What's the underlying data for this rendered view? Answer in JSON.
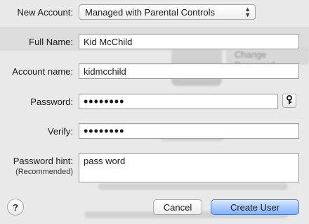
{
  "labels": {
    "new_account": "New Account:",
    "full_name": "Full Name:",
    "account_name": "Account name:",
    "password": "Password:",
    "verify": "Verify:",
    "password_hint": "Password hint:",
    "recommended": "(Recommended)"
  },
  "fields": {
    "account_type": "Managed with Parental Controls",
    "full_name": "Kid McChild",
    "account_name": "kidmcchild",
    "password_masked": "••••••••",
    "verify_masked": "••••••••",
    "password_hint": "pass word"
  },
  "buttons": {
    "help": "?",
    "cancel": "Cancel",
    "create_user": "Create User"
  },
  "background": {
    "faded_button_text": "Change Password"
  },
  "colors": {
    "primary_button": "#7fb2ff",
    "sheet_background": "#e9e9e9"
  }
}
